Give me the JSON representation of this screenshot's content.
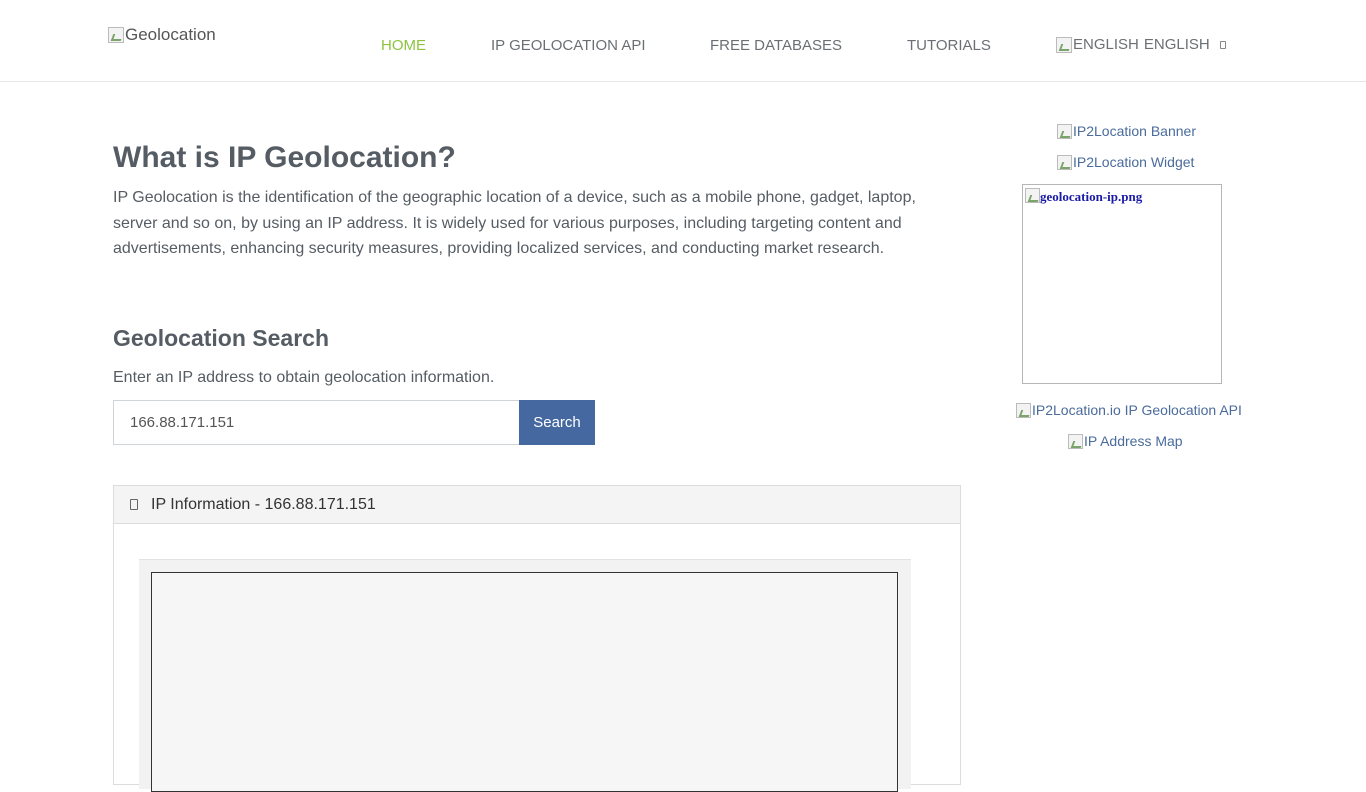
{
  "header": {
    "logo_alt": "Geolocation",
    "nav": [
      {
        "label": "HOME",
        "active": true
      },
      {
        "label": "IP GEOLOCATION API",
        "active": false
      },
      {
        "label": "FREE DATABASES",
        "active": false
      },
      {
        "label": "TUTORIALS",
        "active": false
      }
    ],
    "language": {
      "flag_alt": "ENGLISH",
      "label": "ENGLISH"
    }
  },
  "main": {
    "title": "What is IP Geolocation?",
    "intro": "IP Geolocation is the identification of the geographic location of a device, such as a mobile phone, gadget, laptop, server and so on, by using an IP address. It is widely used for various purposes, including targeting content and advertisements, enhancing security measures, providing localized services, and conducting market research.",
    "search": {
      "title": "Geolocation Search",
      "hint": "Enter an IP address to obtain geolocation information.",
      "input_value": "166.88.171.151",
      "button_label": "Search"
    },
    "panel": {
      "title": "IP Information - 166.88.171.151"
    }
  },
  "sidebar": {
    "links": [
      "IP2Location Banner",
      "IP2Location Widget",
      "IP2Location.io IP Geolocation API",
      "IP Address Map"
    ],
    "box_alt_text": "geolocation-ip.png"
  },
  "colors": {
    "nav_active": "#8cc43f",
    "button": "#44689f",
    "link": "#4a6b9c"
  }
}
